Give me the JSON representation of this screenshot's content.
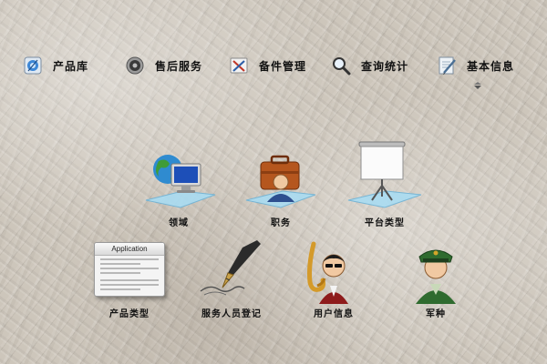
{
  "menu": {
    "items": [
      {
        "label": "产品库",
        "icon": "product-library-icon"
      },
      {
        "label": "售后服务",
        "icon": "speaker-icon"
      },
      {
        "label": "备件管理",
        "icon": "tools-icon"
      },
      {
        "label": "查询统计",
        "icon": "magnifier-icon"
      },
      {
        "label": "基本信息",
        "icon": "notepad-pen-icon"
      }
    ]
  },
  "desktop": {
    "icons": [
      {
        "label": "领域",
        "icon": "globe-computer-icon"
      },
      {
        "label": "职务",
        "icon": "briefcase-user-icon"
      },
      {
        "label": "平台类型",
        "icon": "projector-screen-icon"
      },
      {
        "label": "产品类型",
        "icon": "application-window-icon",
        "window_title": "Application"
      },
      {
        "label": "服务人员登记",
        "icon": "fountain-pen-icon"
      },
      {
        "label": "用户信息",
        "icon": "saxophone-user-icon"
      },
      {
        "label": "军种",
        "icon": "soldier-icon"
      }
    ]
  },
  "colors": {
    "background": "#cdc6bb",
    "platform_glow": "#a9dcf2",
    "text": "#111111"
  }
}
